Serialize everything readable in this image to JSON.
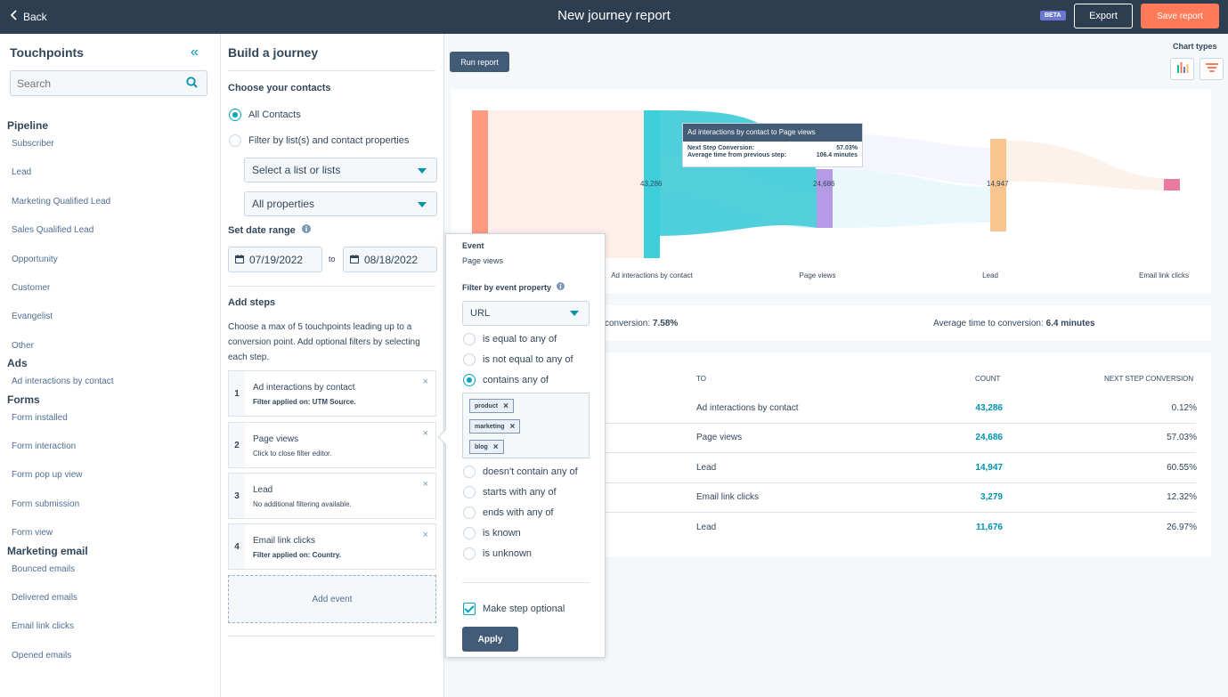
{
  "header": {
    "back_label": "Back",
    "title": "New journey report",
    "beta": "BETA",
    "export_label": "Export",
    "save_label": "Save report"
  },
  "touchpoints": {
    "title": "Touchpoints",
    "search_placeholder": "Search",
    "groups": [
      {
        "name": "Pipeline",
        "items": [
          "Subscriber",
          "Lead",
          "Marketing Qualified Lead",
          "Sales Qualified Lead",
          "Opportunity",
          "Customer",
          "Evangelist",
          "Other"
        ]
      },
      {
        "name": "Ads",
        "items": [
          "Ad interactions by contact"
        ]
      },
      {
        "name": "Forms",
        "items": [
          "Form installed",
          "Form interaction",
          "Form pop up view",
          "Form submission",
          "Form view"
        ]
      },
      {
        "name": "Marketing email",
        "items": [
          "Bounced emails",
          "Delivered emails",
          "Email link clicks",
          "Opened emails"
        ]
      }
    ]
  },
  "build": {
    "title": "Build a journey",
    "contacts_heading": "Choose your contacts",
    "all_contacts": "All Contacts",
    "filter_by_list": "Filter by list(s) and contact properties",
    "select_list": "Select a list or lists",
    "all_properties": "All properties",
    "date_heading": "Set date range",
    "date_from": "07/19/2022",
    "date_to_label": "to",
    "date_to": "08/18/2022",
    "steps_heading": "Add steps",
    "steps_desc": "Choose a max of 5 touchpoints leading up to a conversion point. Add optional filters by selecting each step.",
    "steps": [
      {
        "num": "1",
        "name": "Ad interactions by contact",
        "sub": "Filter applied on: UTM Source."
      },
      {
        "num": "2",
        "name": "Page views",
        "sub": "Click to close filter editor."
      },
      {
        "num": "3",
        "name": "Lead",
        "sub": "No additional filtering available."
      },
      {
        "num": "4",
        "name": "Email link clicks",
        "sub": "Filter applied on: Country."
      }
    ],
    "add_event": "Add event"
  },
  "report": {
    "run_label": "Run report",
    "chart_types_label": "Chart types",
    "node_values": [
      "43,286",
      "24,686",
      "14,947"
    ],
    "step_labels": [
      "Ad interactions by contact",
      "Page views",
      "Lead",
      "Email link clicks"
    ],
    "tooltip": {
      "title": "Ad interactions by contact to Page views",
      "conv_label": "Next Step Conversion:",
      "conv_value": "57.03%",
      "time_label": "Average time from previous step:",
      "time_value": "106.4 minutes"
    },
    "summary": {
      "conv_label": "conversion:",
      "conv_value": "7.58%",
      "time_label": "Average time to conversion:",
      "time_value": "6.4 minutes"
    },
    "table": {
      "headers": [
        "TO",
        "COUNT",
        "NEXT STEP CONVERSION"
      ],
      "rows": [
        {
          "to": "Ad interactions by contact",
          "count": "43,286",
          "conv": "0.12%"
        },
        {
          "to": "Page views",
          "count": "24,686",
          "conv": "57.03%"
        },
        {
          "to": "Lead",
          "count": "14,947",
          "conv": "60.55%"
        },
        {
          "to": "Email link clicks",
          "count": "3,279",
          "conv": "12.32%"
        },
        {
          "to": "Lead",
          "count": "11,676",
          "conv": "26.97%"
        }
      ]
    }
  },
  "filter_popover": {
    "event_label": "Event",
    "event_value": "Page views",
    "filter_heading": "Filter by event property",
    "property": "URL",
    "operators": [
      "is equal to any of",
      "is not equal to any of",
      "contains any of",
      "doesn't contain any of",
      "starts with any of",
      "ends with any of",
      "is known",
      "is unknown"
    ],
    "tags": [
      "product",
      "marketing",
      "blog"
    ],
    "optional_label": "Make step optional",
    "apply_label": "Apply"
  },
  "colors": {
    "topbar": "#2d3e50",
    "accent": "#00a4bd",
    "save": "#ff7a59",
    "link": "#0091ae"
  }
}
